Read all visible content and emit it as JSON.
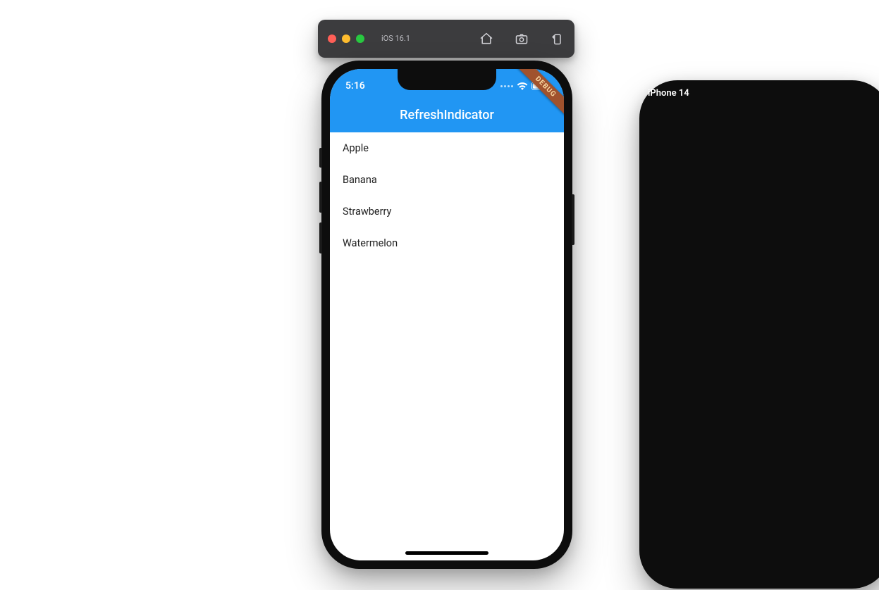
{
  "simulator": {
    "device": "iPhone 14",
    "os": "iOS 16.1",
    "icons": {
      "home": "home-icon",
      "screenshot": "camera-icon",
      "rotate": "rotate-icon"
    }
  },
  "status": {
    "time": "5:16"
  },
  "appbar": {
    "title": "RefreshIndicator"
  },
  "debug_banner": "DEBUG",
  "list": {
    "items": [
      "Apple",
      "Banana",
      "Strawberry",
      "Watermelon"
    ]
  },
  "colors": {
    "appbar": "#2196f3",
    "debug_banner": "#a0522d"
  }
}
